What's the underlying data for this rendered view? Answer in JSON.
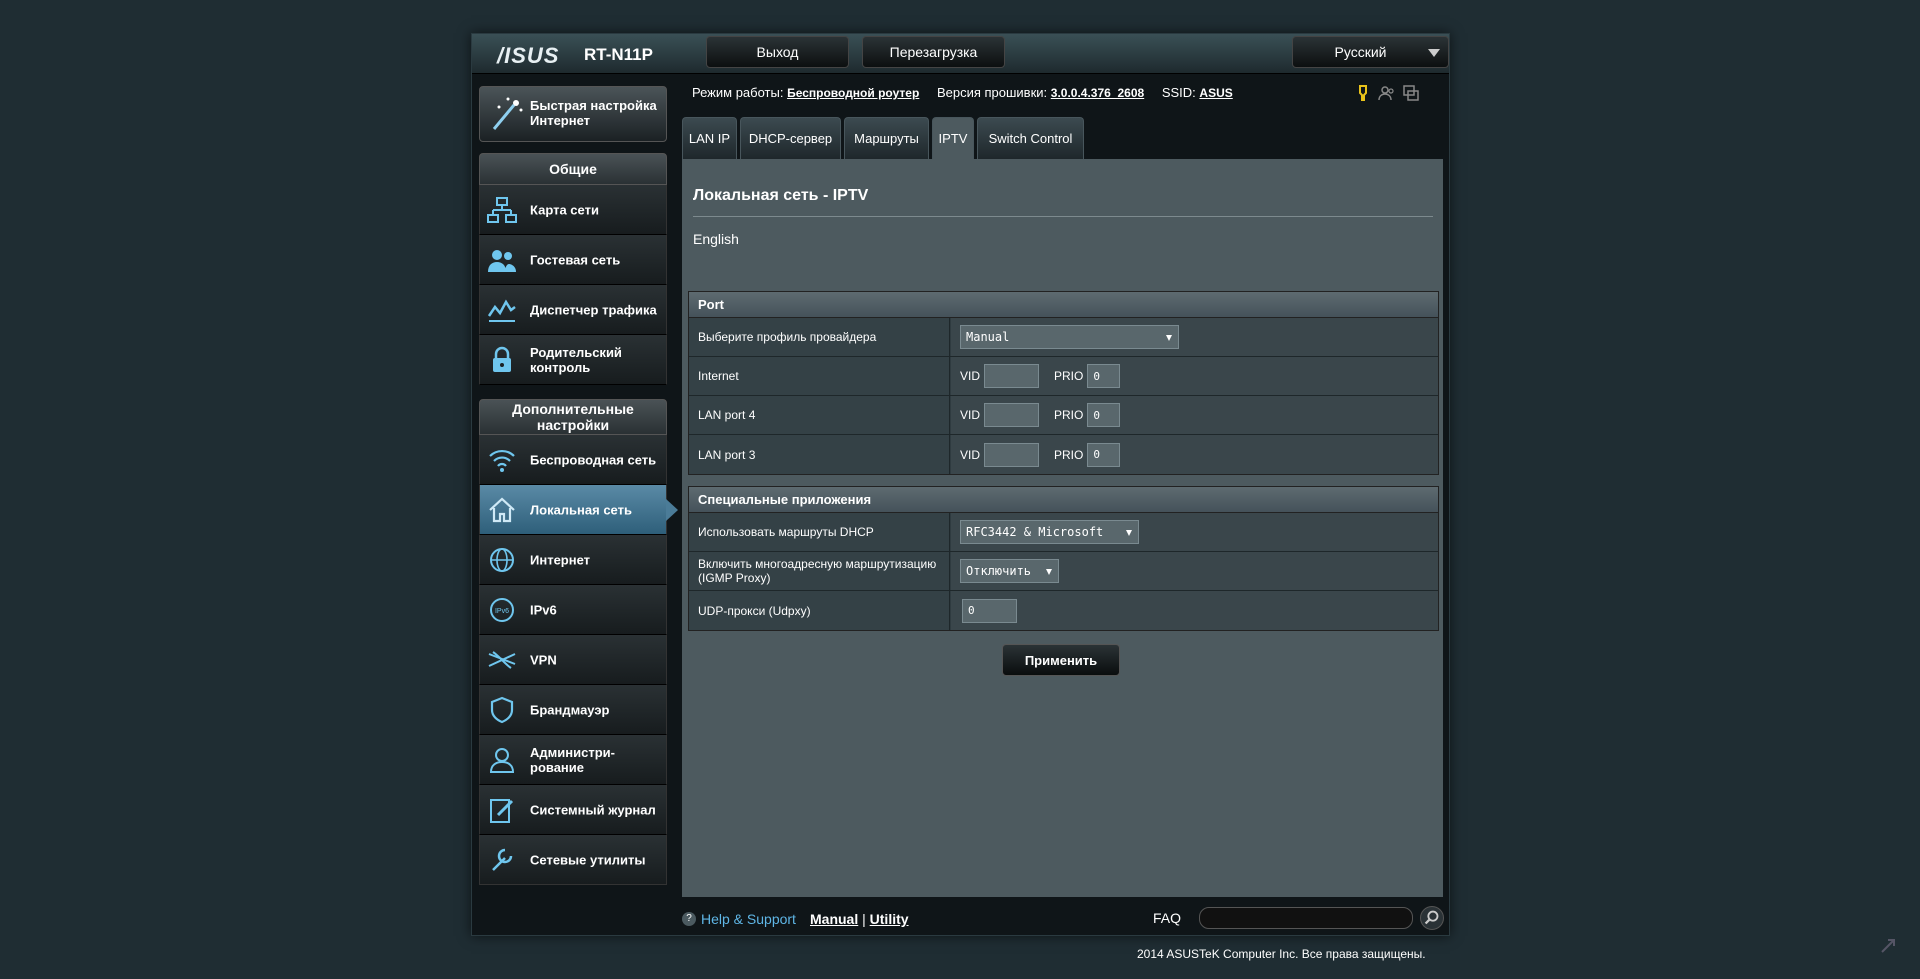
{
  "header": {
    "logo": "/ISUS",
    "model": "RT-N11P",
    "logout_label": "Выход",
    "reboot_label": "Перезагрузка",
    "language": "Русский"
  },
  "sidebar": {
    "quick_setup": "Быстрая настройка Интернет",
    "general_heading": "Общие",
    "general_items": [
      {
        "label": "Карта сети",
        "icon": "network-map-icon"
      },
      {
        "label": "Гостевая сеть",
        "icon": "guest-network-icon"
      },
      {
        "label": "Диспетчер трафика",
        "icon": "traffic-manager-icon"
      },
      {
        "label": "Родительский контроль",
        "icon": "lock-icon"
      }
    ],
    "advanced_heading": "Дополнительные настройки",
    "advanced_items": [
      {
        "label": "Беспроводная сеть",
        "icon": "wifi-icon"
      },
      {
        "label": "Локальная сеть",
        "icon": "home-icon",
        "active": true
      },
      {
        "label": "Интернет",
        "icon": "globe-icon"
      },
      {
        "label": "IPv6",
        "icon": "ipv6-icon"
      },
      {
        "label": "VPN",
        "icon": "vpn-icon"
      },
      {
        "label": "Брандмауэр",
        "icon": "shield-icon"
      },
      {
        "label": "Администри-рование",
        "icon": "admin-user-icon"
      },
      {
        "label": "Системный журнал",
        "icon": "log-icon"
      },
      {
        "label": "Сетевые утилиты",
        "icon": "tools-icon"
      }
    ]
  },
  "status": {
    "mode_label": "Режим работы:",
    "mode_value": "Беспроводной роутер",
    "firmware_label": "Версия прошивки:",
    "firmware_value": "3.0.0.4.376_2608",
    "ssid_label": "SSID:",
    "ssid_value": "ASUS"
  },
  "tabs": [
    "LAN IP",
    "DHCP-сервер",
    "Маршруты",
    "IPTV",
    "Switch Control"
  ],
  "active_tab": "IPTV",
  "page": {
    "title": "Локальная сеть - IPTV",
    "description": "English"
  },
  "port_section": {
    "heading": "Port",
    "profile_label": "Выберите профиль провайдера",
    "profile_value": "Manual",
    "rows": [
      {
        "label": "Internet",
        "vid_label": "VID",
        "vid": "",
        "prio_label": "PRIO",
        "prio": "0"
      },
      {
        "label": "LAN port 4",
        "vid_label": "VID",
        "vid": "",
        "prio_label": "PRIO",
        "prio": "0"
      },
      {
        "label": "LAN port 3",
        "vid_label": "VID",
        "vid": "",
        "prio_label": "PRIO",
        "prio": "0"
      }
    ]
  },
  "special_section": {
    "heading": "Специальные приложения",
    "dhcp_routes_label": "Использовать маршруты DHCP",
    "dhcp_routes_value": "RFC3442 & Microsoft",
    "igmp_label": "Включить многоадресную маршрутизацию (IGMP Proxy)",
    "igmp_value": "Отключить",
    "udpxy_label": "UDP-прокси (Udpxy)",
    "udpxy_value": "0"
  },
  "apply_label": "Применить",
  "footer": {
    "help": "Help & Support",
    "manual": "Manual",
    "separator": "|",
    "utility": "Utility",
    "faq": "FAQ"
  },
  "copyright": "2014  ASUSTeK Computer Inc. Все права защищены."
}
